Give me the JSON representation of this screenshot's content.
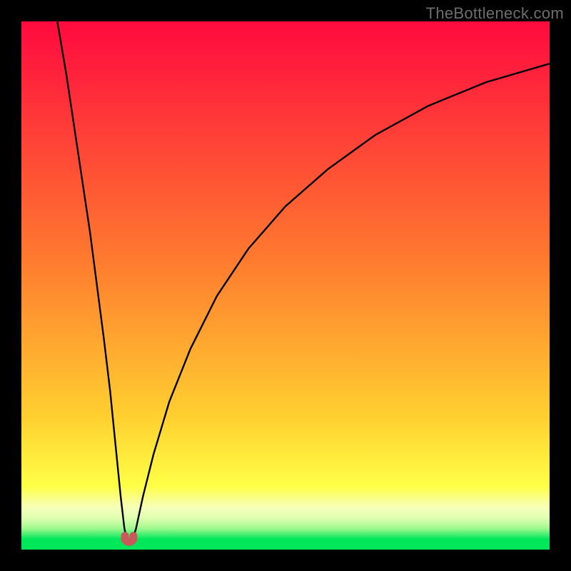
{
  "watermark": "TheBottleneck.com",
  "colors": {
    "red_top": "#ff0a3f",
    "orange_mid": "#ffb030",
    "yellow": "#ffff46",
    "pale_yellow": "#f6ffba",
    "green": "#00e85a",
    "black": "#000000",
    "curve": "#000000",
    "marker": "#c85a5a"
  },
  "chart_data": {
    "type": "line",
    "title": "",
    "xlabel": "",
    "ylabel": "",
    "xlim": [
      0,
      100
    ],
    "ylim": [
      0,
      100
    ],
    "curve": {
      "min_x": 20,
      "left": [
        {
          "x": 6.8,
          "y": 100
        },
        {
          "x": 8.5,
          "y": 90
        },
        {
          "x": 10.0,
          "y": 80
        },
        {
          "x": 11.5,
          "y": 70
        },
        {
          "x": 13.0,
          "y": 60
        },
        {
          "x": 14.3,
          "y": 50
        },
        {
          "x": 15.6,
          "y": 40
        },
        {
          "x": 16.8,
          "y": 30
        },
        {
          "x": 17.8,
          "y": 20
        },
        {
          "x": 18.8,
          "y": 10
        },
        {
          "x": 19.5,
          "y": 4
        },
        {
          "x": 20.0,
          "y": 1.7
        },
        {
          "x": 20.5,
          "y": 1.5
        }
      ],
      "right": [
        {
          "x": 20.5,
          "y": 1.5
        },
        {
          "x": 21.0,
          "y": 1.7
        },
        {
          "x": 21.7,
          "y": 4
        },
        {
          "x": 23.0,
          "y": 10
        },
        {
          "x": 25.0,
          "y": 18
        },
        {
          "x": 28.0,
          "y": 28
        },
        {
          "x": 32.0,
          "y": 38
        },
        {
          "x": 37.0,
          "y": 48
        },
        {
          "x": 43.0,
          "y": 57
        },
        {
          "x": 50.0,
          "y": 65
        },
        {
          "x": 58.0,
          "y": 72
        },
        {
          "x": 67.0,
          "y": 78.5
        },
        {
          "x": 77.0,
          "y": 84
        },
        {
          "x": 88.0,
          "y": 88.5
        },
        {
          "x": 100.0,
          "y": 92
        }
      ]
    },
    "marker": {
      "points": [
        {
          "x": 19.6,
          "y": 2.6
        },
        {
          "x": 21.2,
          "y": 2.6
        }
      ],
      "style": "U-shape-connector"
    },
    "background_bands": [
      {
        "from_y": 100,
        "to_y": 55,
        "gradient": [
          "#ff0a3f",
          "#ff7a2f"
        ]
      },
      {
        "from_y": 55,
        "to_y": 25,
        "gradient": [
          "#ff7a2f",
          "#ffd030"
        ]
      },
      {
        "from_y": 25,
        "to_y": 12,
        "gradient": [
          "#ffd030",
          "#ffff46"
        ]
      },
      {
        "from_y": 12,
        "to_y": 8,
        "gradient": [
          "#ffff46",
          "#f6ffba"
        ]
      },
      {
        "from_y": 8,
        "to_y": 6,
        "gradient": [
          "#f6ffba",
          "#e0ffb0"
        ]
      },
      {
        "from_y": 6,
        "to_y": 4,
        "gradient": [
          "#e0ffb0",
          "#a0f890"
        ]
      },
      {
        "from_y": 4,
        "to_y": 2.0,
        "gradient": [
          "#a0f890",
          "#00e85a"
        ]
      },
      {
        "from_y": 2.0,
        "to_y": 0,
        "color": "#00e85a"
      }
    ]
  }
}
